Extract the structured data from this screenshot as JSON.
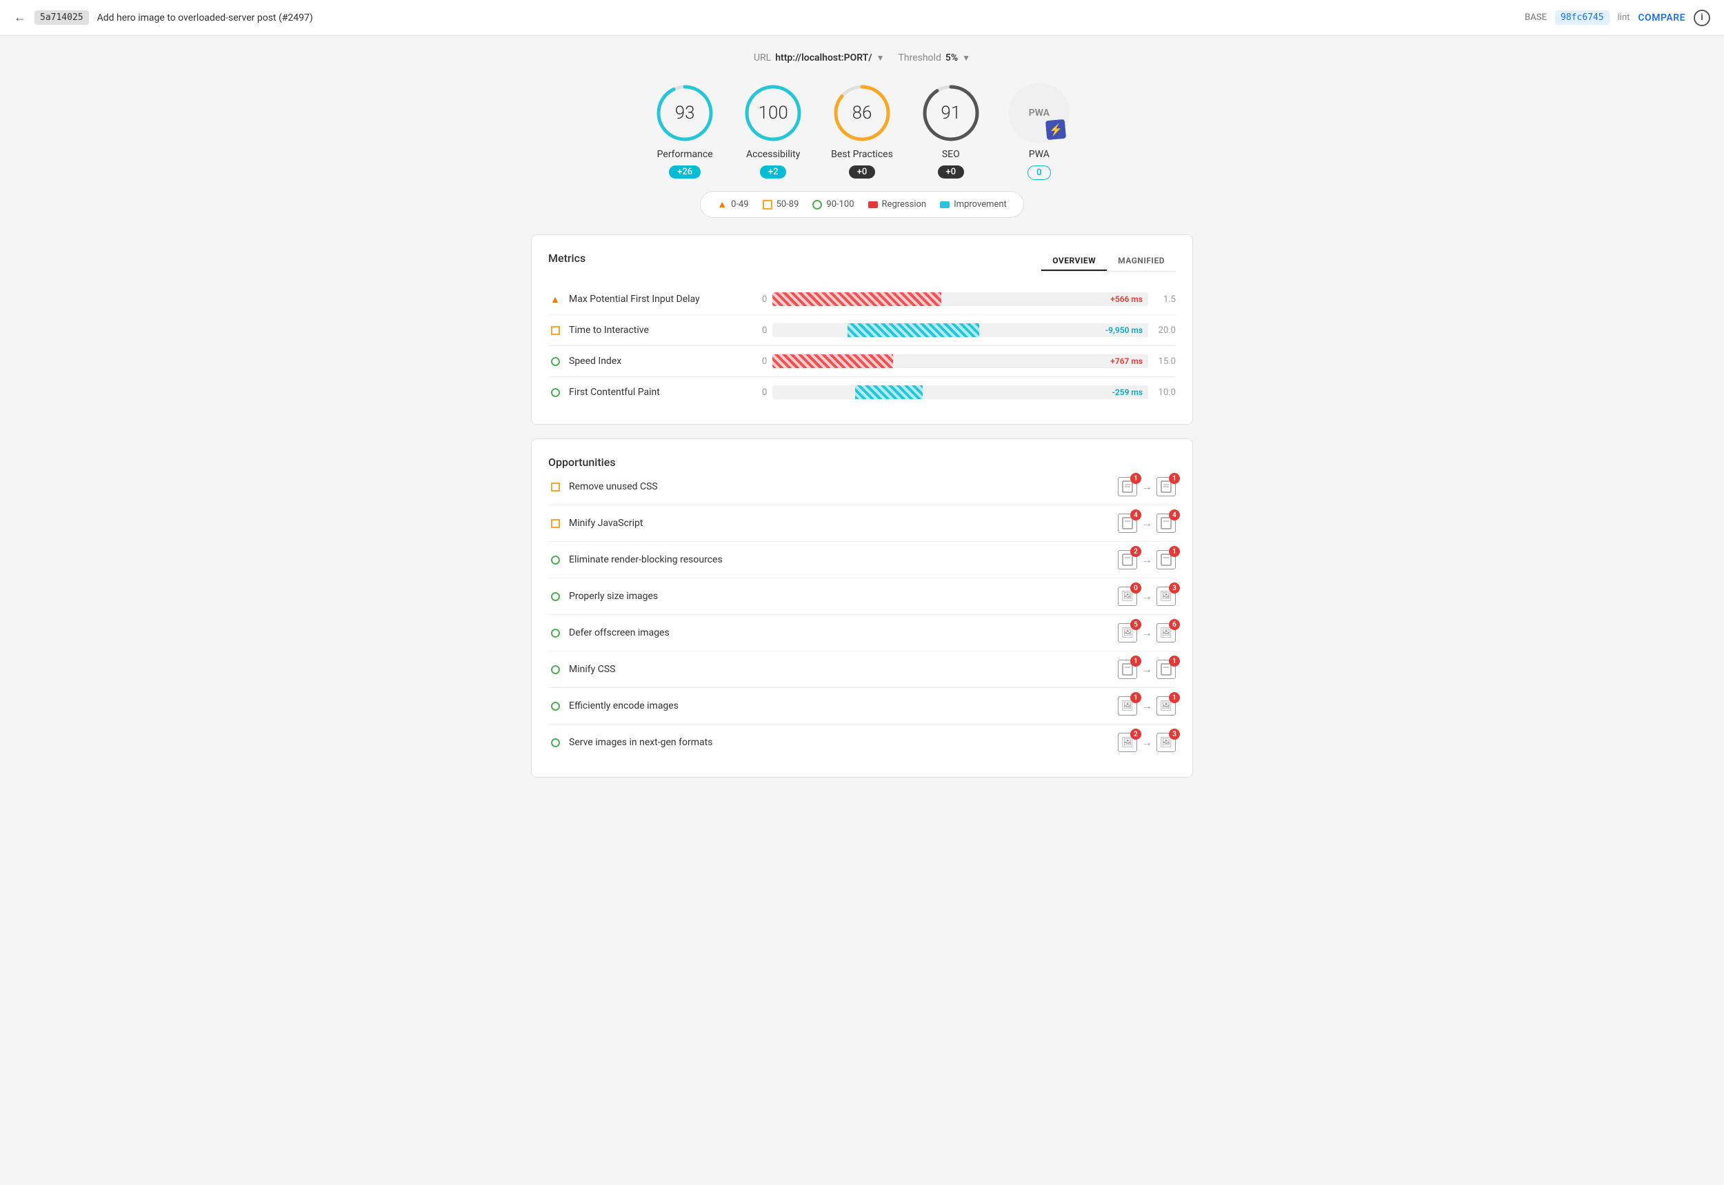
{
  "header": {
    "back_label": "←",
    "commit_base": "5a714025",
    "commit_title": "Add hero image to overloaded-server post (#2497)",
    "base_label": "BASE",
    "commit_compare": "98fc6745",
    "lint_label": "lint",
    "compare_label": "COMPARE",
    "info_label": "i"
  },
  "url_row": {
    "url_label": "URL",
    "url_value": "http://localhost:PORT/",
    "threshold_label": "Threshold",
    "threshold_value": "5%"
  },
  "scores": [
    {
      "id": "performance",
      "value": "93",
      "label": "Performance",
      "badge": "+26",
      "badge_type": "teal",
      "color": "#26c6da",
      "bg": "#f0f0f0",
      "stroke_color": "#26c6da",
      "pct": 93
    },
    {
      "id": "accessibility",
      "value": "100",
      "label": "Accessibility",
      "badge": "+2",
      "badge_type": "teal",
      "color": "#26c6da",
      "bg": "#f0f0f0",
      "stroke_color": "#26c6da",
      "pct": 100
    },
    {
      "id": "best-practices",
      "value": "86",
      "label": "Best Practices",
      "badge": "+0",
      "badge_type": "dark",
      "color": "#f9a825",
      "stroke_color": "#f9a825",
      "pct": 86
    },
    {
      "id": "seo",
      "value": "91",
      "label": "SEO",
      "badge": "+0",
      "badge_type": "dark",
      "color": "#333",
      "stroke_color": "#555",
      "pct": 91
    },
    {
      "id": "pwa",
      "value": "PWA",
      "label": "PWA",
      "badge": "0",
      "badge_type": "outline"
    }
  ],
  "legend": {
    "items": [
      {
        "type": "triangle",
        "label": "0-49"
      },
      {
        "type": "square-orange",
        "label": "50-89"
      },
      {
        "type": "circle-green",
        "label": "90-100"
      },
      {
        "type": "rect-red",
        "label": "Regression"
      },
      {
        "type": "rect-teal",
        "label": "Improvement"
      }
    ]
  },
  "metrics": {
    "title": "Metrics",
    "tabs": [
      {
        "id": "overview",
        "label": "OVERVIEW",
        "active": true
      },
      {
        "id": "magnified",
        "label": "MAGNIFIED",
        "active": false
      }
    ],
    "rows": [
      {
        "id": "max-potential-fid",
        "icon": "triangle",
        "name": "Max Potential First Input Delay",
        "zero": "0",
        "bar_type": "red",
        "bar_width": "45%",
        "bar_label": "+566 ms",
        "score": "1.5"
      },
      {
        "id": "time-to-interactive",
        "icon": "square-orange",
        "name": "Time to Interactive",
        "zero": "0",
        "bar_type": "teal",
        "bar_offset": "30%",
        "bar_width": "35%",
        "bar_label": "-9,950 ms",
        "score": "20.0"
      },
      {
        "id": "speed-index",
        "icon": "circle-green",
        "name": "Speed Index",
        "zero": "0",
        "bar_type": "red",
        "bar_width": "32%",
        "bar_label": "+767 ms",
        "score": "15.0"
      },
      {
        "id": "first-contentful-paint",
        "icon": "circle-green",
        "name": "First Contentful Paint",
        "zero": "0",
        "bar_type": "teal",
        "bar_offset": "28%",
        "bar_width": "18%",
        "bar_label": "-259 ms",
        "score": "10.0"
      }
    ]
  },
  "opportunities": {
    "title": "Opportunities",
    "rows": [
      {
        "id": "remove-unused-css",
        "icon": "square-orange",
        "name": "Remove unused CSS",
        "from_count": "1",
        "to_count": "1",
        "to_badge": "red"
      },
      {
        "id": "minify-javascript",
        "icon": "square-orange",
        "name": "Minify JavaScript",
        "from_count": "4",
        "to_count": "4",
        "to_badge": "red"
      },
      {
        "id": "eliminate-render-blocking",
        "icon": "circle-green",
        "name": "Eliminate render-blocking resources",
        "from_count": "2",
        "to_count": "1",
        "to_badge": "red"
      },
      {
        "id": "properly-size-images",
        "icon": "circle-green",
        "name": "Properly size images",
        "from_count": "0",
        "to_count": "3",
        "to_badge": "red",
        "from_type": "img",
        "to_type": "img"
      },
      {
        "id": "defer-offscreen-images",
        "icon": "circle-green",
        "name": "Defer offscreen images",
        "from_count": "5",
        "to_count": "6",
        "to_badge": "red",
        "from_type": "img",
        "to_type": "img"
      },
      {
        "id": "minify-css",
        "icon": "circle-green",
        "name": "Minify CSS",
        "from_count": "1",
        "to_count": "1",
        "to_badge": "red"
      },
      {
        "id": "efficiently-encode-images",
        "icon": "circle-green",
        "name": "Efficiently encode images",
        "from_count": "1",
        "to_count": "1",
        "to_badge": "red",
        "from_type": "img",
        "to_type": "img"
      },
      {
        "id": "serve-next-gen-formats",
        "icon": "circle-green",
        "name": "Serve images in next-gen formats",
        "from_count": "2",
        "to_count": "3",
        "to_badge": "red",
        "from_type": "img",
        "to_type": "img"
      }
    ]
  }
}
